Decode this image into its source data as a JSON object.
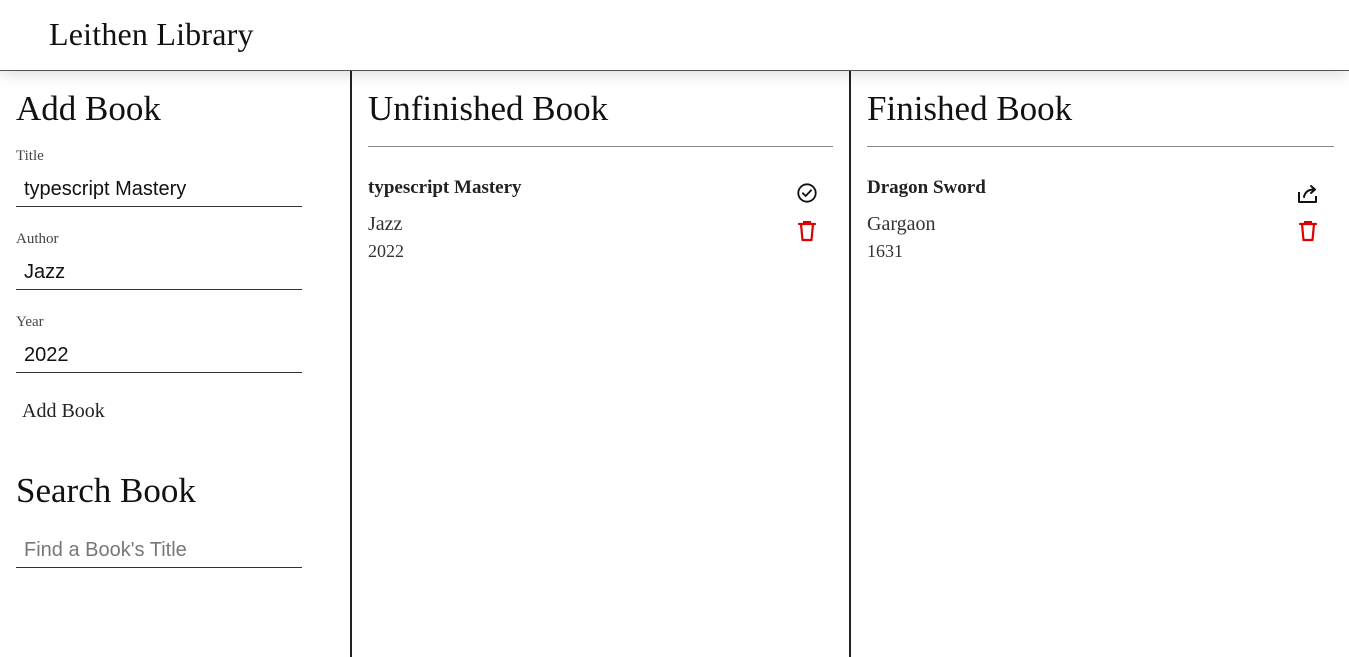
{
  "app": {
    "title": "Leithen Library"
  },
  "add_book": {
    "heading": "Add Book",
    "title_label": "Title",
    "title_value": "typescript Mastery",
    "author_label": "Author",
    "author_value": "Jazz",
    "year_label": "Year",
    "year_value": "2022",
    "submit_label": "Add Book"
  },
  "search_book": {
    "heading": "Search Book",
    "placeholder": "Find a Book's Title",
    "value": ""
  },
  "unfinished": {
    "heading": "Unfinished Book",
    "books": [
      {
        "title": "typescript Mastery",
        "author": "Jazz",
        "year": "2022"
      }
    ],
    "icons": {
      "primary": "check-circle-icon",
      "secondary": "trash-icon"
    }
  },
  "finished": {
    "heading": "Finished Book",
    "books": [
      {
        "title": "Dragon Sword",
        "author": "Gargaon",
        "year": "1631"
      }
    ],
    "icons": {
      "primary": "share-undo-icon",
      "secondary": "trash-icon"
    }
  },
  "colors": {
    "accent_delete": "#e00000",
    "text": "#111111",
    "divider": "#8a8a8a",
    "column_border": "#222222"
  }
}
